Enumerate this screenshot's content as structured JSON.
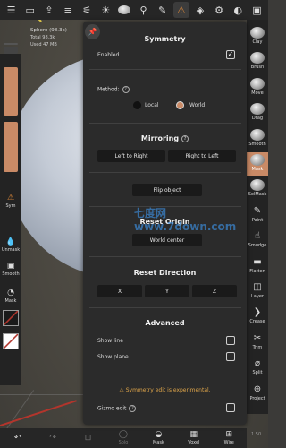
{
  "topbar": {
    "icons": [
      "menu-icon",
      "folder-icon",
      "share-icon",
      "layers-icon",
      "settings-sliders-icon",
      "sun-icon",
      "material-ball-icon",
      "brush-icon",
      "pencil-icon",
      "warning-icon",
      "cube-icon",
      "gear-icon",
      "adjust-icon",
      "camera-icon"
    ]
  },
  "info": {
    "title": "Sphere (98.3k)",
    "total": "Total 98.3k",
    "used": "Used 47 MB"
  },
  "left": {
    "sym": "Sym",
    "unmask": "Unmask",
    "smooth": "Smooth",
    "mask": "Mask"
  },
  "tools": [
    "Clay",
    "Brush",
    "Move",
    "Drag",
    "Smooth",
    "Mask",
    "SelMask",
    "Paint",
    "Smudge",
    "Flatten",
    "Layer",
    "Crease",
    "Trim",
    "Split",
    "Project"
  ],
  "bottom": {
    "items": [
      "",
      "",
      "",
      "Solo",
      "Mask",
      "Voxel",
      "Wire"
    ],
    "version": "1.50"
  },
  "panel": {
    "symmetry_title": "Symmetry",
    "enabled_label": "Enabled",
    "enabled_check": "✓",
    "method_label": "Method:",
    "local_label": "Local",
    "world_label": "World",
    "mirroring_title": "Mirroring",
    "left_to_right": "Left to Right",
    "right_to_left": "Right to Left",
    "flip_object": "Flip object",
    "reset_origin_title": "Reset Origin",
    "world_center": "World center",
    "reset_direction_title": "Reset Direction",
    "x": "X",
    "y": "Y",
    "z": "Z",
    "advanced_title": "Advanced",
    "show_line": "Show line",
    "show_plane": "Show plane",
    "warning": "Symmetry edit is experimental.",
    "gizmo_edit": "Gizmo edit"
  },
  "watermark": "七度网 www.7down.com",
  "colors": {
    "accent": "#c98a66",
    "warning": "#e0a64a",
    "panel_bg": "#2b2b2b"
  }
}
